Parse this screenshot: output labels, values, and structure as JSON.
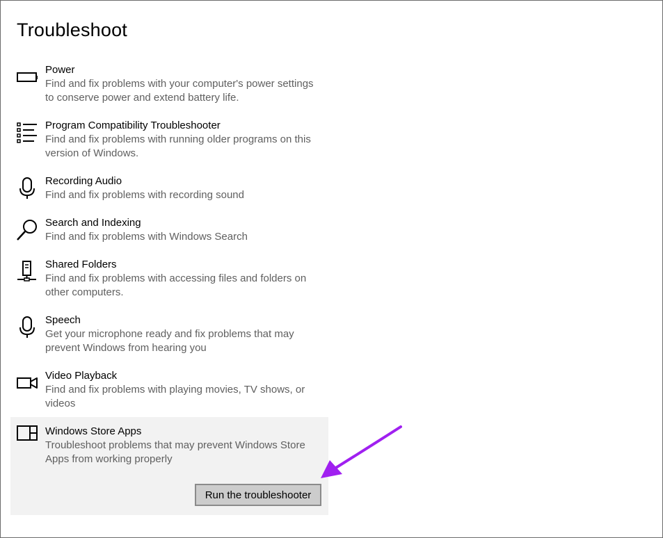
{
  "page": {
    "title": "Troubleshoot"
  },
  "items": [
    {
      "title": "Power",
      "desc": "Find and fix problems with your computer's power settings to conserve power and extend battery life.",
      "icon": "battery-icon"
    },
    {
      "title": "Program Compatibility Troubleshooter",
      "desc": "Find and fix problems with running older programs on this version of Windows.",
      "icon": "list-icon"
    },
    {
      "title": "Recording Audio",
      "desc": "Find and fix problems with recording sound",
      "icon": "microphone-icon"
    },
    {
      "title": "Search and Indexing",
      "desc": "Find and fix problems with Windows Search",
      "icon": "search-icon"
    },
    {
      "title": "Shared Folders",
      "desc": "Find and fix problems with accessing files and folders on other computers.",
      "icon": "network-computer-icon"
    },
    {
      "title": "Speech",
      "desc": "Get your microphone ready and fix problems that may prevent Windows from hearing you",
      "icon": "microphone-icon"
    },
    {
      "title": "Video Playback",
      "desc": "Find and fix problems with playing movies, TV shows, or videos",
      "icon": "video-camera-icon"
    },
    {
      "title": "Windows Store Apps",
      "desc": "Troubleshoot problems that may prevent Windows Store Apps from working properly",
      "icon": "store-apps-icon"
    }
  ],
  "selected_item": "Windows Store Apps",
  "run_button": {
    "label": "Run the troubleshooter"
  },
  "annotation": {
    "icon": "pointer-arrow-icon",
    "color": "#a020f0"
  }
}
